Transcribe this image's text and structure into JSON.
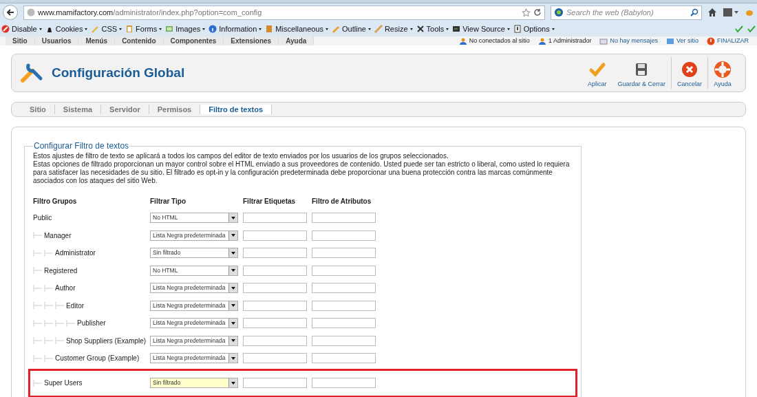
{
  "browser": {
    "url_host": "www.mamifactory.com",
    "url_path": "/administrator/index.php?option=com_config",
    "search_placeholder": "Search the web (Babylon)"
  },
  "dev_toolbar": [
    {
      "label": "Disable"
    },
    {
      "label": "Cookies"
    },
    {
      "label": "CSS"
    },
    {
      "label": "Forms"
    },
    {
      "label": "Images"
    },
    {
      "label": "Information"
    },
    {
      "label": "Miscellaneous"
    },
    {
      "label": "Outline"
    },
    {
      "label": "Resize"
    },
    {
      "label": "Tools"
    },
    {
      "label": "View Source"
    },
    {
      "label": "Options"
    }
  ],
  "admin_menu": [
    "Sitio",
    "Usuarios",
    "Menús",
    "Contenido",
    "Componentes",
    "Extensiones",
    "Ayuda"
  ],
  "status": [
    {
      "label": "No conectados al sitio",
      "link": false
    },
    {
      "label": "1 Administrador",
      "link": false
    },
    {
      "label": "No hay mensajes",
      "link": true
    },
    {
      "label": "Ver sitio",
      "link": true
    },
    {
      "label": "FINALIZAR",
      "link": true
    }
  ],
  "page_title": "Configuración Global",
  "actions": [
    {
      "label": "Aplicar"
    },
    {
      "label": "Guardar & Cerrar"
    },
    {
      "label": "Cancelar"
    },
    {
      "label": "Ayuda"
    }
  ],
  "tabs": [
    {
      "label": "Sitio",
      "selected": false
    },
    {
      "label": "Sistema",
      "selected": false
    },
    {
      "label": "Servidor",
      "selected": false
    },
    {
      "label": "Permisos",
      "selected": false
    },
    {
      "label": "Filtro de textos",
      "selected": true
    }
  ],
  "fieldset": {
    "legend": "Configurar Filtro de textos",
    "paragraphs": [
      "Estos ajustes de filtro de texto se aplicará a todos los campos del editor de texto enviados por los usuarios de los grupos seleccionados.",
      "Estas opciones de filtrado proporcionan un mayor control sobre el HTML enviado a sus proveedores de contenido. Usted puede ser tan estricto o liberal, como usted lo requiera para satisfacer las necesidades de su sitio. El filtrado es opt-in y la configuración predeterminada debe proporcionar una buena protección contra las marcas comúnmente asociados con los ataques del sitio Web."
    ]
  },
  "table": {
    "columns": [
      "Filtro Grupos",
      "Filtrar Tipo",
      "Filtrar Etiquetas",
      "Filtro de Atributos"
    ],
    "groups": [
      {
        "name": "Public",
        "filter": "No HTML",
        "highlighted": false,
        "children": [
          {
            "name": "Manager",
            "filter": "Lista Negra predeterminada",
            "highlighted": false,
            "children": [
              {
                "name": "Administrator",
                "filter": "Sin filtrado",
                "highlighted": false
              }
            ]
          },
          {
            "name": "Registered",
            "filter": "No HTML",
            "highlighted": false,
            "children": [
              {
                "name": "Author",
                "filter": "Lista Negra predeterminada",
                "highlighted": false,
                "children": [
                  {
                    "name": "Editor",
                    "filter": "Lista Negra predeterminada",
                    "highlighted": false,
                    "children": [
                      {
                        "name": "Publisher",
                        "filter": "Lista Negra predeterminada",
                        "highlighted": false
                      }
                    ]
                  },
                  {
                    "name": "Shop Suppliers (Example)",
                    "filter": "Lista Negra predeterminada",
                    "highlighted": false
                  }
                ]
              },
              {
                "name": "Customer Group (Example)",
                "filter": "Lista Negra predeterminada",
                "highlighted": false
              }
            ]
          },
          {
            "name": "Super Users",
            "filter": "Sin filtrado",
            "highlighted": true
          }
        ]
      }
    ]
  }
}
